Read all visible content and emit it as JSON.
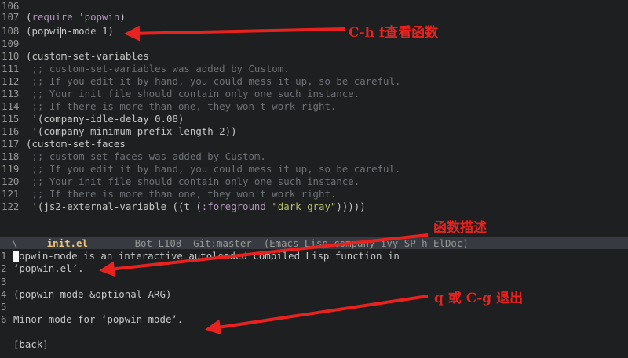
{
  "editor": {
    "lines": [
      {
        "num": "106"
      },
      {
        "num": "107",
        "pre": "(",
        "kw": "require",
        "mid": " '",
        "sym": "popwin",
        "post": ")"
      },
      {
        "num": "108",
        "a": "(popwi",
        "b": "n-mode 1)"
      },
      {
        "num": "109"
      },
      {
        "num": "110",
        "text": "(custom-set-variables"
      },
      {
        "num": "111",
        "comment": " ;; custom-set-variables was added by Custom."
      },
      {
        "num": "112",
        "comment": " ;; If you edit it by hand, you could mess it up, so be careful."
      },
      {
        "num": "113",
        "comment": " ;; Your init file should contain only one such instance."
      },
      {
        "num": "114",
        "comment": " ;; If there is more than one, they won't work right."
      },
      {
        "num": "115",
        "text": " '(company-idle-delay 0.08)"
      },
      {
        "num": "116",
        "text": " '(company-minimum-prefix-length 2))"
      },
      {
        "num": "117",
        "text": "(custom-set-faces"
      },
      {
        "num": "118",
        "comment": " ;; custom-set-faces was added by Custom."
      },
      {
        "num": "119",
        "comment": " ;; If you edit it by hand, you could mess it up, so be careful."
      },
      {
        "num": "120",
        "comment": " ;; Your init file should contain only one such instance."
      },
      {
        "num": "121",
        "comment": " ;; If there is more than one, they won't work right."
      },
      {
        "num": "122",
        "pre": " '(js2-external-variable ((t (",
        "kw": ":foreground",
        "mid": " ",
        "str": "\"dark gray\"",
        "post": ")))))"
      }
    ]
  },
  "modeline": {
    "prefix": " -\\---  ",
    "buffer": "init.el",
    "rest": "        Bot L108  Git:master  (Emacs-Lisp company ivy SP h ElDoc)"
  },
  "help": {
    "l1_num": "1",
    "l1_text": "opwin-mode is an interactive autoloaded compiled Lisp function in",
    "l2_num": "2",
    "l2_pre": "‘",
    "l2_link": "popwin.el",
    "l2_post": "’.",
    "l3_num": "3",
    "l4_num": "4",
    "l4_text": "(popwin-mode &optional ARG)",
    "l5_num": "5",
    "l6_num": "6",
    "l6_pre": "Minor mode for ‘",
    "l6_link": "popwin-mode",
    "l6_post": "’.",
    "back": "[back]"
  },
  "annotations": {
    "a1": "C-h f查看函数",
    "a2": "函数描述",
    "a3": "q 或 C-g 退出"
  },
  "colors": {
    "background": "#1d1f21",
    "annotation": "#e8231f",
    "comment": "#6f7276",
    "keyword": "#b294bb",
    "string": "#b5bd68"
  }
}
